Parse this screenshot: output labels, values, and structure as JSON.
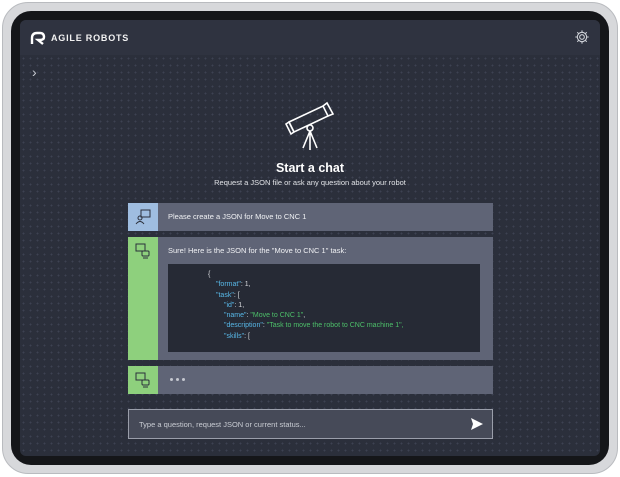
{
  "header": {
    "brand": "AGILE ROBOTS",
    "settings_icon": "gear-icon"
  },
  "sidebar_toggle": "chevron-right-icon",
  "hero": {
    "title": "Start a chat",
    "subtitle": "Request a JSON file or ask any question about your robot"
  },
  "messages": [
    {
      "role": "user",
      "text": "Please create a JSON for Move to CNC 1"
    },
    {
      "role": "bot",
      "text": "Sure! Here is the JSON for the \"Move to CNC 1\" task:",
      "code": {
        "open": "{",
        "l1k": "\"format\"",
        "l1v": ": 1,",
        "l2k": "\"task\"",
        "l2v": ": [",
        "l3k": "\"id\"",
        "l3v": ": 1,",
        "l4k": "\"name\"",
        "l4v": "\"Move to CNC 1\"",
        "l5k": "\"description\"",
        "l5v": "\"Task to move the robot to CNC machine 1\",",
        "l6k": "\"skills\"",
        "l6v": ": ["
      }
    },
    {
      "role": "bot",
      "status": "typing"
    }
  ],
  "input": {
    "placeholder": "Type a question, request JSON or current status..."
  },
  "colors": {
    "user_avatar": "#9fbde0",
    "bot_avatar": "#8ed07d",
    "key": "#58b8e8",
    "string": "#4dc06a"
  }
}
